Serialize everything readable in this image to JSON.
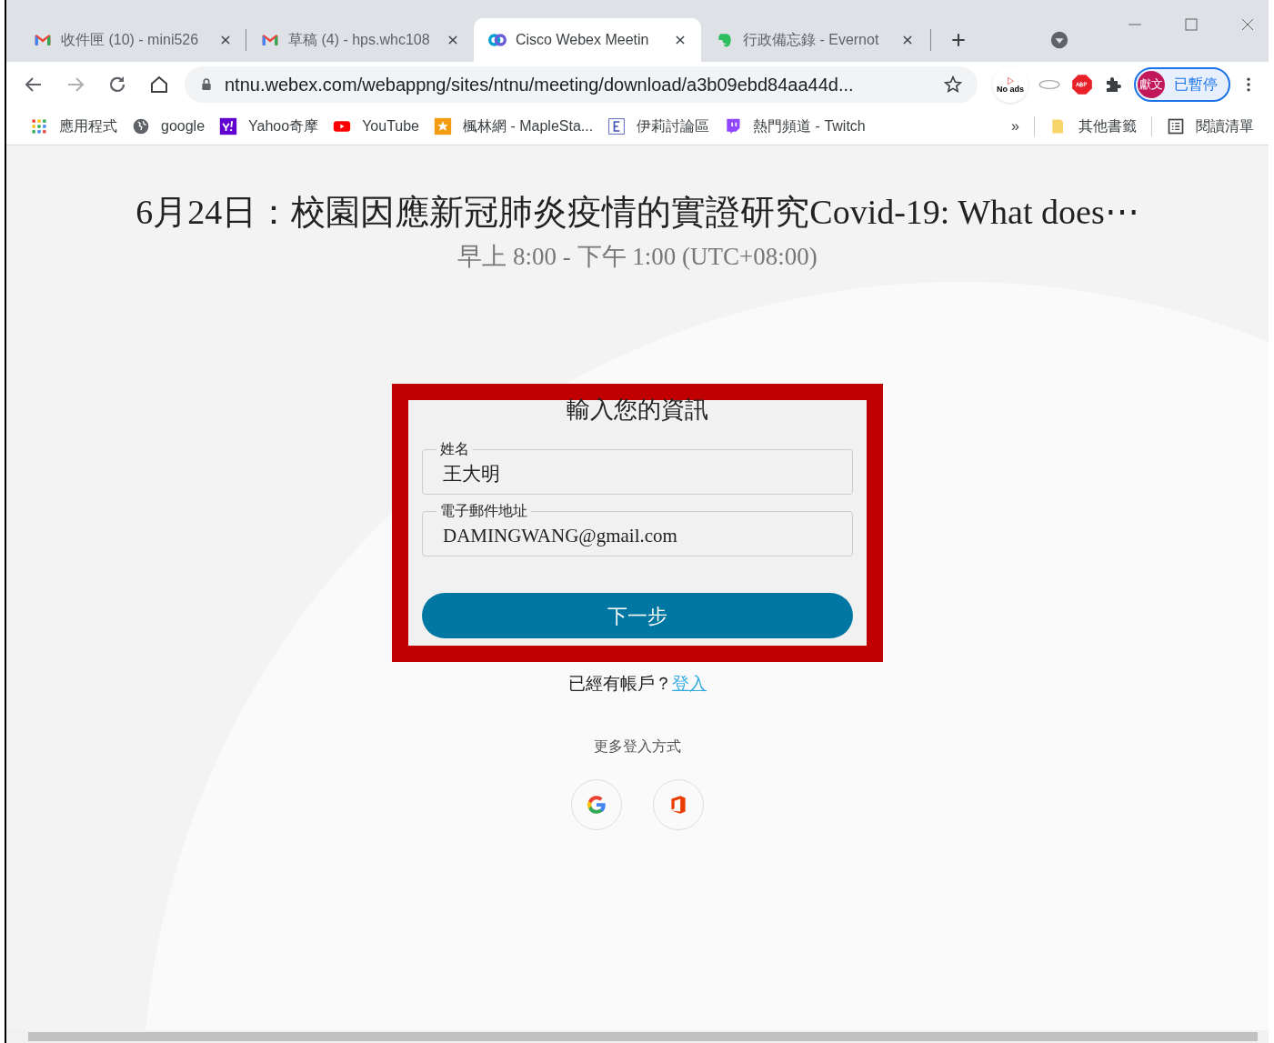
{
  "browser": {
    "tabs": [
      {
        "title": "收件匣 (10) - mini526",
        "kind": "gmail",
        "selected": false
      },
      {
        "title": "草稿 (4) - hps.whc108",
        "kind": "gmail",
        "selected": false
      },
      {
        "title": "Cisco Webex Meetin",
        "kind": "webex",
        "selected": true
      },
      {
        "title": "行政備忘錄 - Evernot",
        "kind": "evernote",
        "selected": false
      }
    ],
    "address": "ntnu.webex.com/webappng/sites/ntnu/meeting/download/a3b09ebd84aa44d...",
    "extension_label": "No ads",
    "profile": {
      "initials": "獻文",
      "status": "已暫停"
    },
    "bookmarks": [
      {
        "label": "應用程式",
        "kind": "apps"
      },
      {
        "label": "google",
        "kind": "globe"
      },
      {
        "label": "Yahoo奇摩",
        "kind": "yahoo"
      },
      {
        "label": "YouTube",
        "kind": "youtube"
      },
      {
        "label": "楓林網 - MapleSta...",
        "kind": "star"
      },
      {
        "label": "伊莉討論區",
        "kind": "e"
      },
      {
        "label": "熱門頻道 - Twitch",
        "kind": "twitch"
      }
    ],
    "overflow": "»",
    "other_bookmarks": "其他書籤",
    "reading_list": "閱讀清單"
  },
  "page": {
    "title": "6月24日：校園因應新冠肺炎疫情的實證研究Covid-19: What does⋯",
    "time": "早上 8:00 - 下午 1:00 (UTC+08:00)",
    "form": {
      "heading": "輸入您的資訊",
      "fields": [
        {
          "label": "姓名",
          "value": "王大明"
        },
        {
          "label": "電子郵件地址",
          "value": "DAMINGWANG@gmail.com"
        }
      ],
      "button": "下一步"
    },
    "account_prompt": "已經有帳戶？",
    "sign_in_link": "登入",
    "more_options": "更多登入方式",
    "sso": [
      {
        "kind": "google"
      },
      {
        "kind": "office"
      }
    ]
  }
}
